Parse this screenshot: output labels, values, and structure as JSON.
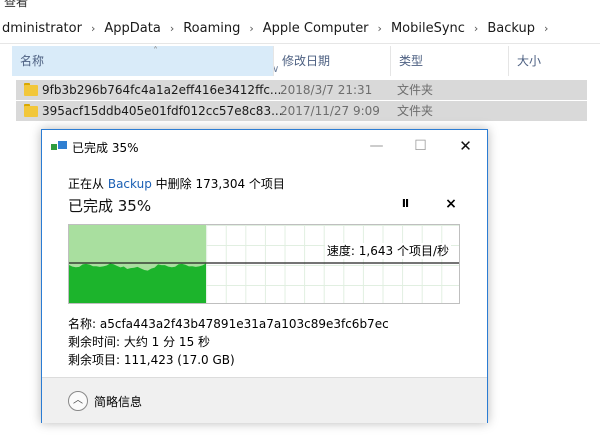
{
  "menu": {
    "partial_label": "查看"
  },
  "breadcrumb": [
    "dministrator",
    "AppData",
    "Roaming",
    "Apple Computer",
    "MobileSync",
    "Backup"
  ],
  "columns": {
    "name": "名称",
    "date": "修改日期",
    "type": "类型",
    "size": "大小"
  },
  "files": [
    {
      "name": "9fb3b296b764fc4a1a2eff416e3412ffc...",
      "date": "2018/3/7 21:31",
      "type": "文件夹"
    },
    {
      "name": "395acf15ddb405e01fdf012cc57e8c83...",
      "date": "2017/11/27 9:09",
      "type": "文件夹"
    }
  ],
  "dialog": {
    "title": "已完成 35%",
    "status_prefix": "正在从",
    "status_source": "Backup",
    "status_suffix": "中删除 173,304 个项目",
    "headline": "已完成 35%",
    "pause_label": "II",
    "cancel_label": "×",
    "speed": "速度: 1,643 个项目/秒",
    "progress_fraction": 0.35,
    "name_line": "名称: a5cfa443a2f43b47891e31a7a103c89e3fc6b7ec",
    "remaining_time": "剩余时间: 大约 1 分 15 秒",
    "remaining_items": "剩余项目: 111,423 (17.0 GB)",
    "toggle_icon": "︿",
    "toggle_label": "简略信息"
  },
  "window_controls": {
    "minimize": "—",
    "maximize": "☐",
    "close": "✕"
  },
  "colors": {
    "accent": "#2b7cd3",
    "progress_fill": "#a9df9f",
    "throughput": "#1cb42c",
    "link": "#1a5fb4"
  }
}
